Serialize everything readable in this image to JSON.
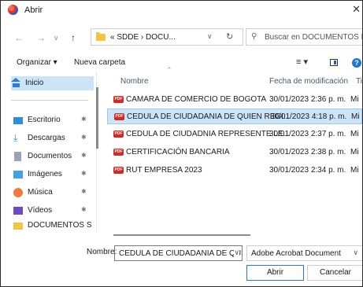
{
  "window": {
    "title": "Abrir",
    "close": "✕"
  },
  "address": {
    "path": "« SDDE › DOCU...",
    "search_placeholder": "Buscar en DOCUMENTOS RE..."
  },
  "toolbar": {
    "organize": "Organizar ▾",
    "new_folder": "Nueva carpeta",
    "view": "≡ ▾",
    "help": "?"
  },
  "nav": {
    "items": [
      {
        "label": "Inicio",
        "icon": "home-icon"
      },
      {
        "label": "Escritorio",
        "icon": "desktop-icon"
      },
      {
        "label": "Descargas",
        "icon": "download-icon"
      },
      {
        "label": "Documentos",
        "icon": "documents-icon"
      },
      {
        "label": "Imágenes",
        "icon": "pictures-icon"
      },
      {
        "label": "Música",
        "icon": "music-icon"
      },
      {
        "label": "Vídeos",
        "icon": "videos-icon"
      },
      {
        "label": "DOCUMENTOS S",
        "icon": "folder-icon"
      }
    ],
    "pin": "✱"
  },
  "columns": {
    "name": "Nombre",
    "date": "Fecha de modificación",
    "type": "Tip"
  },
  "files": [
    {
      "name": "CAMARA DE COMERCIO DE BOGOTA",
      "date": "30/01/2023 2:36 p. m.",
      "type": "Mi"
    },
    {
      "name": "CEDULA DE CIUDADANIA DE QUIEN REGI...",
      "date": "30/01/2023 4:18 p. m.",
      "type": "Mi"
    },
    {
      "name": "CEDULA DE CIUDADNIA REPRESENTE LE...",
      "date": "30/01/2023 2:37 p. m.",
      "type": "Mi"
    },
    {
      "name": "CERTIFICACIÓN BANCARIA",
      "date": "30/01/2023 2:38 p. m.",
      "type": "Mi"
    },
    {
      "name": "RUT EMPRESA 2023",
      "date": "30/01/2023 2:34 p. m.",
      "type": "Mi"
    }
  ],
  "file_icon_text": "PDF",
  "bottom": {
    "name_label": "Nombre:",
    "name_value": "CEDULA DE CIUDADANIA DE QUIEN",
    "file_type": "Adobe Acrobat Document",
    "open": "Abrir",
    "cancel": "Cancelar"
  },
  "colors": {
    "selection": "#cce4f7",
    "accent": "#2b78d4",
    "pdf": "#d42a25"
  }
}
